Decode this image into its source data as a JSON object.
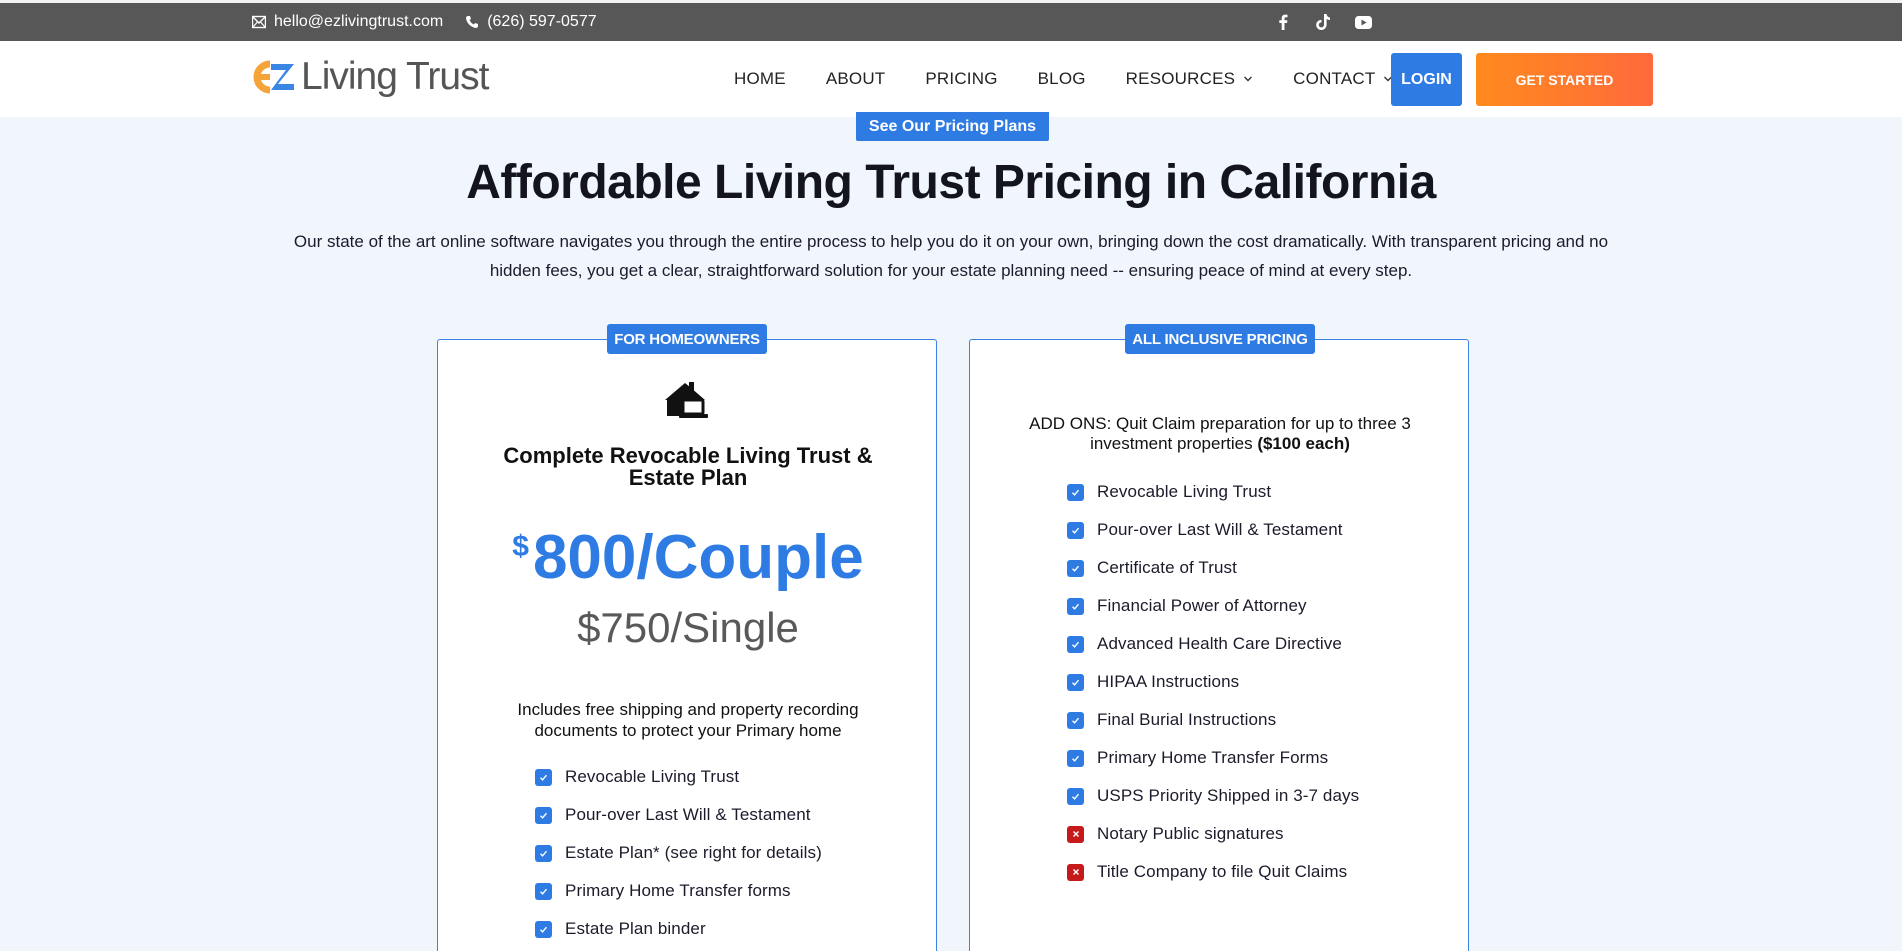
{
  "topbar": {
    "email": "hello@ezlivingtrust.com",
    "phone": "(626) 597-0577",
    "social_icons": [
      "facebook-icon",
      "tiktok-icon",
      "youtube-icon"
    ]
  },
  "nav": {
    "logo_text": "Living Trust",
    "logo_mark": "EZ",
    "items": [
      {
        "label": "HOME"
      },
      {
        "label": "ABOUT"
      },
      {
        "label": "PRICING"
      },
      {
        "label": "BLOG"
      },
      {
        "label": "RESOURCES"
      },
      {
        "label": "CONTACT"
      }
    ],
    "login_label": "LOGIN",
    "cta_label": "GET STARTED"
  },
  "hero": {
    "pill_label": "See Our Pricing Plans",
    "title": "Affordable Living Trust Pricing in California",
    "intro": "Our state of the art online software navigates you through the entire process to help you do it on your own, bringing down the cost dramatically. With transparent pricing and no hidden fees, you get a clear, straightforward solution for your estate planning need -- ensuring peace of mind at every step."
  },
  "plan_card": {
    "tag": "FOR HOMEOWNERS",
    "title": "Complete Revocable Living Trust & Estate Plan",
    "currency": "$",
    "price_main": "800/Couple",
    "price_single": "$750/Single",
    "includes": "Includes free shipping and property recording documents to protect your Primary home",
    "features": [
      "Revocable Living Trust",
      "Pour-over Last Will & Testament",
      "Estate Plan* (see right for details)",
      "Primary Home Transfer forms",
      "Estate Plan binder"
    ]
  },
  "inclusive_card": {
    "tag": "ALL INCLUSIVE PRICING",
    "addons_text": "ADD ONS: Quit Claim preparation for up to three 3 investment properties ",
    "addons_bold": "($100 each)",
    "features": [
      {
        "label": "Revocable Living Trust",
        "included": true
      },
      {
        "label": "Pour-over Last Will & Testament",
        "included": true
      },
      {
        "label": "Certificate of Trust",
        "included": true
      },
      {
        "label": "Financial Power of Attorney",
        "included": true
      },
      {
        "label": "Advanced Health Care Directive",
        "included": true
      },
      {
        "label": "HIPAA Instructions",
        "included": true
      },
      {
        "label": "Final Burial Instructions",
        "included": true
      },
      {
        "label": "Primary Home Transfer Forms",
        "included": true
      },
      {
        "label": "USPS Priority Shipped in 3-7 days",
        "included": true
      },
      {
        "label": "Notary Public signatures",
        "included": false
      },
      {
        "label": "Title Company to file Quit Claims",
        "included": false
      }
    ]
  },
  "colors": {
    "accent_blue": "#2d7be3",
    "accent_orange": "#ff7a2a",
    "topbar_bg": "#575757",
    "page_bg": "#f1f6fd",
    "excluded_red": "#c61a1a"
  }
}
